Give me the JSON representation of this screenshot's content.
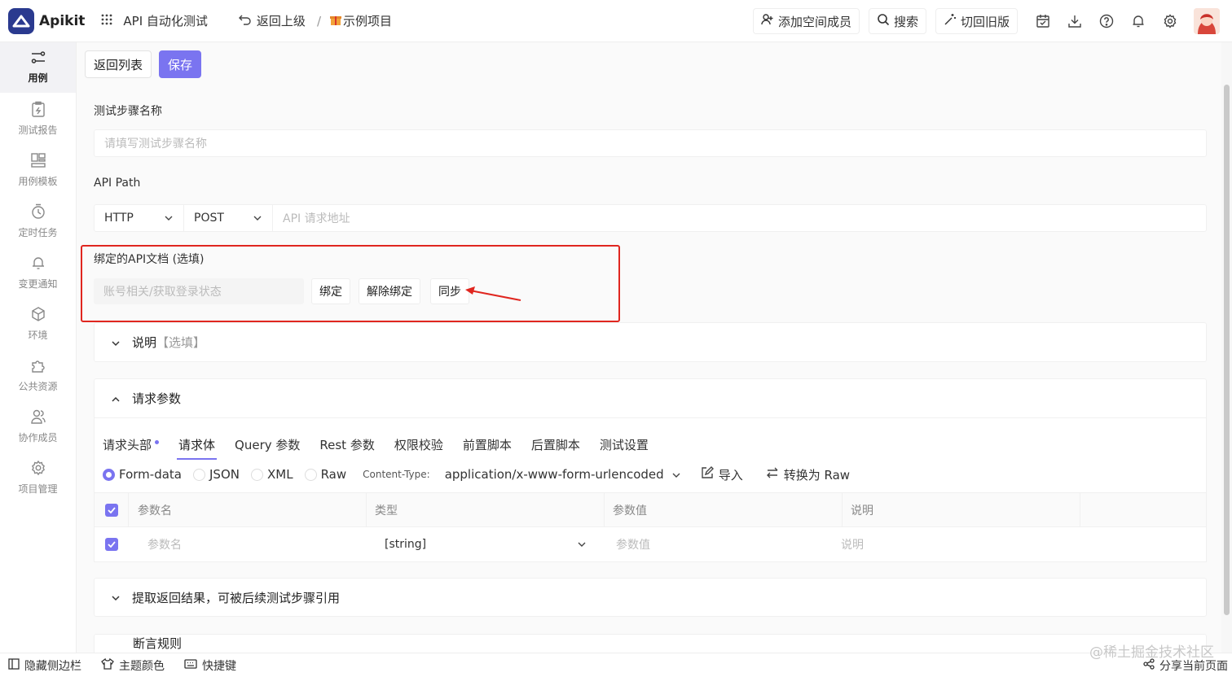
{
  "app": {
    "logo_text": "Apikit",
    "module": "API 自动化测试",
    "back_parent": "返回上级",
    "breadcrumb_sep": "/",
    "project": "示例项目"
  },
  "header_actions": {
    "add_member": "添加空间成员",
    "search": "搜索",
    "old_version": "切回旧版"
  },
  "sidebar": {
    "items": [
      {
        "label": "用例",
        "icon": "case-icon"
      },
      {
        "label": "测试报告",
        "icon": "report-icon"
      },
      {
        "label": "用例模板",
        "icon": "template-icon"
      },
      {
        "label": "定时任务",
        "icon": "timer-icon"
      },
      {
        "label": "变更通知",
        "icon": "bell-icon"
      },
      {
        "label": "环境",
        "icon": "environment-icon"
      },
      {
        "label": "公共资源",
        "icon": "puzzle-icon"
      },
      {
        "label": "协作成员",
        "icon": "members-icon"
      },
      {
        "label": "项目管理",
        "icon": "gear-icon"
      }
    ]
  },
  "toolbar": {
    "back_list": "返回列表",
    "save": "保存"
  },
  "form": {
    "step_name_label": "测试步骤名称",
    "step_name_placeholder": "请填写测试步骤名称",
    "api_path_label": "API Path",
    "protocol": "HTTP",
    "method": "POST",
    "path_placeholder": "API 请求地址",
    "bound_doc_label": "绑定的API文档 (选填)",
    "bound_doc_value": "账号相关/获取登录状态",
    "bind": "绑定",
    "unbind": "解除绑定",
    "sync": "同步"
  },
  "description_panel": {
    "title": "说明",
    "hint": "【选填】"
  },
  "request_panel": {
    "title": "请求参数",
    "tabs": [
      "请求头部",
      "请求体",
      "Query 参数",
      "Rest 参数",
      "权限校验",
      "前置脚本",
      "后置脚本",
      "测试设置"
    ],
    "active_tab": "请求体",
    "body_types": [
      "Form-data",
      "JSON",
      "XML",
      "Raw"
    ],
    "selected_body_type": "Form-data",
    "content_type_label": "Content-Type:",
    "content_type_value": "application/x-www-form-urlencoded",
    "import": "导入",
    "convert_raw": "转换为 Raw",
    "table_headers": [
      "参数名",
      "类型",
      "参数值",
      "说明"
    ],
    "row": {
      "name_placeholder": "参数名",
      "type": "[string]",
      "value_placeholder": "参数值",
      "desc_placeholder": "说明"
    }
  },
  "extract_panel": {
    "title": "提取返回结果，可被后续测试步骤引用"
  },
  "assert_panel": {
    "title": "断言规则"
  },
  "bottombar": {
    "hide_sidebar": "隐藏侧边栏",
    "theme": "主题颜色",
    "shortcuts": "快捷键",
    "share": "分享当前页面"
  },
  "watermark": "@稀土掘金技术社区",
  "colors": {
    "accent": "#7a74f0",
    "highlight": "#e0261f",
    "logo_bg": "#2a3a8f"
  }
}
